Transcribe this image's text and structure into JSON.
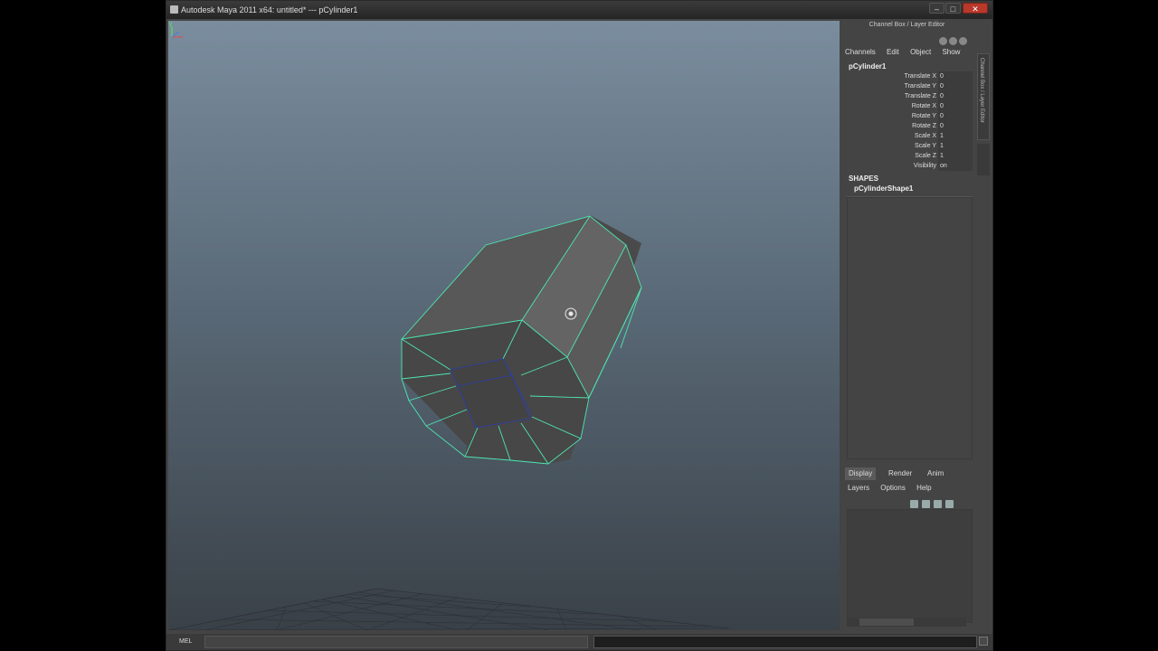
{
  "window": {
    "title": "Autodesk Maya 2011 x64: untitled*   ---   pCylinder1",
    "buttons": {
      "minimize": "–",
      "maximize": "□",
      "close": "✕"
    }
  },
  "channel_box": {
    "header": "Channel Box / Layer Editor",
    "menus": [
      "Channels",
      "Edit",
      "Object",
      "Show"
    ],
    "object_name": "pCylinder1",
    "channels": [
      {
        "label": "Translate X",
        "value": "0"
      },
      {
        "label": "Translate Y",
        "value": "0"
      },
      {
        "label": "Translate Z",
        "value": "0"
      },
      {
        "label": "Rotate X",
        "value": "0"
      },
      {
        "label": "Rotate Y",
        "value": "0"
      },
      {
        "label": "Rotate Z",
        "value": "0"
      },
      {
        "label": "Scale X",
        "value": "1"
      },
      {
        "label": "Scale Y",
        "value": "1"
      },
      {
        "label": "Scale Z",
        "value": "1"
      },
      {
        "label": "Visibility",
        "value": "on"
      }
    ],
    "shapes_label": "SHAPES",
    "shape_name": "pCylinderShape1",
    "side_tab": "Channel Box / Layer Editor"
  },
  "layer_editor": {
    "tabs": [
      "Display",
      "Render",
      "Anim"
    ],
    "active_tab": "Display",
    "menus": [
      "Layers",
      "Options",
      "Help"
    ]
  },
  "command_line": {
    "label": "MEL"
  },
  "viewport": {
    "axis_label": "y"
  },
  "colors": {
    "selection_wire": "#4ee6b0",
    "component_wire": "#2f3e9a",
    "mesh_face": "#505050"
  }
}
